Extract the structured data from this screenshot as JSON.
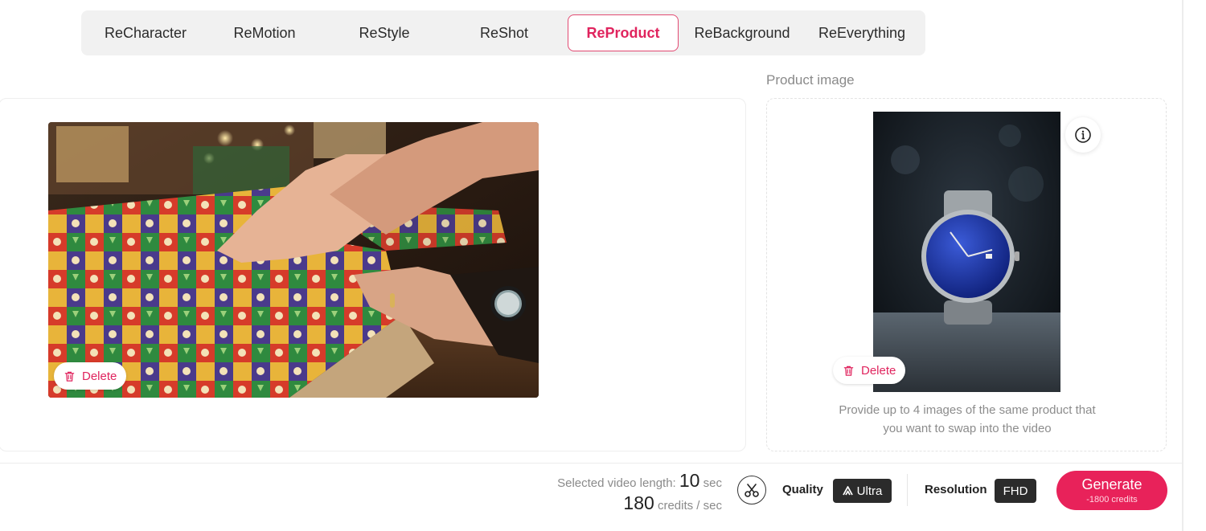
{
  "tabs": [
    {
      "label": "ReCharacter",
      "active": false
    },
    {
      "label": "ReMotion",
      "active": false
    },
    {
      "label": "ReStyle",
      "active": false
    },
    {
      "label": "ReShot",
      "active": false
    },
    {
      "label": "ReProduct",
      "active": true
    },
    {
      "label": "ReBackground",
      "active": false
    },
    {
      "label": "ReEverything",
      "active": false
    }
  ],
  "video": {
    "delete_label": "Delete"
  },
  "product": {
    "section_label": "Product image",
    "delete_label": "Delete",
    "helper_line1": "Provide up to 4 images of the same product that",
    "helper_line2": "you want to swap into the video"
  },
  "footer": {
    "length_prefix": "Selected video length: ",
    "length_value": "10",
    "length_unit": " sec",
    "credits_value": "180",
    "credits_unit": " credits / sec",
    "quality_label": "Quality",
    "quality_value": "Ultra",
    "resolution_label": "Resolution",
    "resolution_value": "FHD",
    "generate_label": "Generate",
    "generate_cost": "-1800 credits"
  },
  "colors": {
    "accent": "#e8225a",
    "active_tab_text": "#e0245e",
    "dark_pill": "#2b2b2b"
  },
  "icons": [
    "trash-icon",
    "info-icon",
    "scissors-icon",
    "ultra-logo-icon"
  ]
}
